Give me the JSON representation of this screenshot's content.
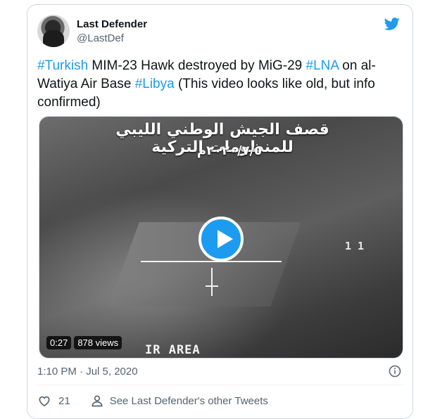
{
  "author": {
    "name": "Last Defender",
    "handle": "@LastDef"
  },
  "tweet": {
    "segments": [
      {
        "text": "#Turkish",
        "hashtag": true
      },
      {
        "text": " MIM-23 Hawk destroyed by MiG-29 ",
        "hashtag": false
      },
      {
        "text": "#LNA",
        "hashtag": true
      },
      {
        "text": " on al-Watiya Air Base ",
        "hashtag": false
      },
      {
        "text": "#Libya",
        "hashtag": true
      },
      {
        "text": " (This video looks like old, but info confirmed)",
        "hashtag": false
      }
    ]
  },
  "video": {
    "overlay_title": "قصف الجيش الوطني الليبي للمنظومات التركية",
    "overlay_date": "٢٠٢٠/٧/٥م",
    "hud_number": "1 1",
    "hud_label": "IR AREA",
    "duration": "0:27",
    "views": "878 views"
  },
  "footer": {
    "timestamp": "1:10 PM · Jul 5, 2020",
    "like_count": "21",
    "see_other": "See Last Defender's other Tweets"
  },
  "colors": {
    "accent": "#1d9bf0",
    "text": "#0f1419",
    "muted": "#536471"
  },
  "icons": [
    "twitter-bird-icon",
    "play-icon",
    "info-icon",
    "heart-icon",
    "person-icon"
  ]
}
